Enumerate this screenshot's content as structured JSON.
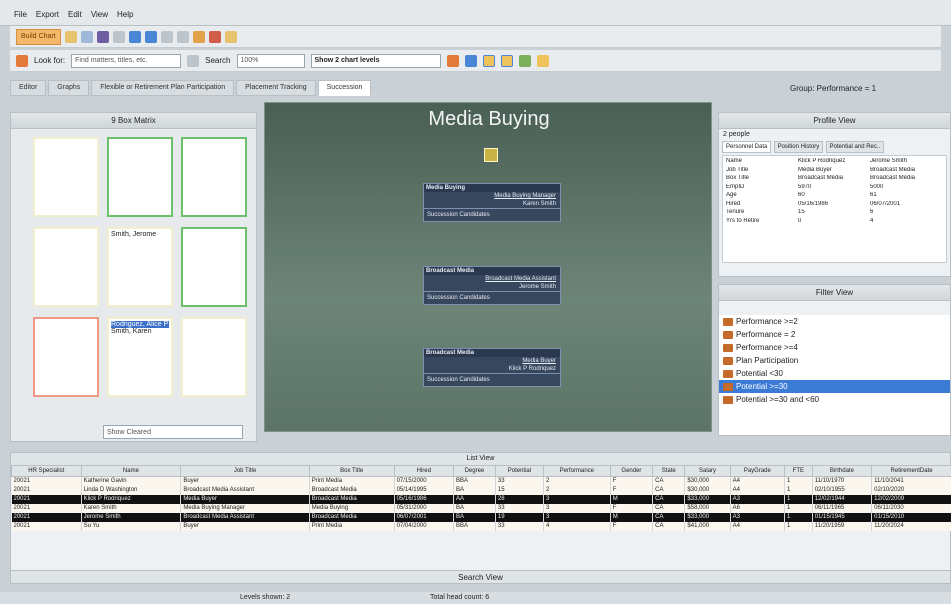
{
  "menu": [
    "File",
    "Export",
    "Edit",
    "View",
    "Help"
  ],
  "toolbar": {
    "main_button": "Build Chart",
    "look_for_label": "Look for:",
    "look_for_placeholder": "Find matters, titles, etc.",
    "search_label": "Search",
    "zoom": "100%",
    "chart_levels": "Show 2 chart levels"
  },
  "tabs": [
    "Editor",
    "Graphs",
    "Flexible or Retirement Plan Participation",
    "Placement Tracking",
    "Succession"
  ],
  "group_label": "Group: Performance = 1",
  "matrix": {
    "title": "9 Box Matrix",
    "cell_names_1": [
      "Smith, Jerome"
    ],
    "cell_names_2": [
      "Rodriguez, Alice P",
      "Smith, Karen"
    ],
    "show_select": "Show Cleared"
  },
  "chart": {
    "title": "Media Buying",
    "nodes": [
      {
        "dept": "Media Buying",
        "title": "Media Buying Manager",
        "name": "Karen Smith",
        "succ": "Succession Candidates"
      },
      {
        "dept": "Broadcast Media",
        "title": "Broadcast Media Assistant",
        "name": "Jerome Smith",
        "succ": "Succession Candidates"
      },
      {
        "dept": "Broadcast Media",
        "title": "Media Buyer",
        "name": "Klick P Rodriquez",
        "succ": "Succession Candidates"
      }
    ]
  },
  "profile": {
    "title": "Profile View",
    "compare": "2 people",
    "tabs": [
      "Personnel Data",
      "Position History",
      "Potential and Rec.."
    ],
    "rows": [
      [
        "Name",
        "Klick P Rodriquez",
        "Jerome Smith"
      ],
      [
        "Job Title",
        "Media Buyer",
        "Broadcast Media"
      ],
      [
        "Box Title",
        "Broadcast Media",
        "Broadcast Media"
      ],
      [
        "EmpID",
        "5970",
        "5000"
      ],
      [
        "Age",
        "60",
        "61"
      ],
      [
        "Hired",
        "05/16/1986",
        "06/07/2001"
      ],
      [
        "Tenure",
        "15",
        "6"
      ],
      [
        "Yrs to Retire",
        "0",
        "4"
      ]
    ]
  },
  "filter": {
    "title": "Filter View",
    "items": [
      "Performance >=2",
      "Performance = 2",
      "Performance >=4",
      "Plan Participation",
      "Potential <30",
      "Potential >=30",
      "Potential >=30 and <60"
    ],
    "selected": 5
  },
  "list": {
    "title": "List View",
    "columns": [
      "HR Specialist",
      "Name",
      "Job Title",
      "Box Title",
      "Hired",
      "Degree",
      "Potential",
      "Performance",
      "Gender",
      "State",
      "Salary",
      "PayGrade",
      "FTE",
      "Birthdate",
      "RetirementDate"
    ],
    "rows": [
      [
        "20021",
        "Katherine Gavin",
        "Buyer",
        "Print Media",
        "07/15/2000",
        "BBA",
        "33",
        "2",
        "F",
        "CA",
        "$30,000",
        "A4",
        "1",
        "11/10/1970",
        "11/10/2041"
      ],
      [
        "20021",
        "Linda D Washington",
        "Broadcast Media Assistant",
        "Broadcast Media",
        "05/14/1995",
        "BA",
        "15",
        "2",
        "F",
        "CA",
        "$30,000",
        "A4",
        "1",
        "02/10/1955",
        "02/10/2020"
      ],
      [
        "20021",
        "Klick P Rodriquez",
        "Media Buyer",
        "Broadcast Media",
        "05/16/1986",
        "AA",
        "28",
        "3",
        "M",
        "CA",
        "$33,000",
        "A3",
        "1",
        "12/02/1944",
        "12/02/2009"
      ],
      [
        "20021",
        "Karen Smith",
        "Media Buying Manager",
        "Media Buying",
        "05/31/2000",
        "BA",
        "33",
        "3",
        "F",
        "CA",
        "$58,000",
        "A6",
        "1",
        "06/11/1965",
        "06/11/2030"
      ],
      [
        "20021",
        "Jerome Smith",
        "Broadcast Media Assistant",
        "Broadcast Media",
        "06/07/2001",
        "BA",
        "19",
        "3",
        "M",
        "CA",
        "$33,000",
        "A3",
        "1",
        "01/15/1945",
        "01/15/2010"
      ],
      [
        "20021",
        "Su Yu",
        "Buyer",
        "Print Media",
        "07/04/2000",
        "BBA",
        "33",
        "4",
        "F",
        "CA",
        "$41,000",
        "A4",
        "1",
        "11/20/1959",
        "11/20/2024"
      ]
    ],
    "row_styles": [
      "light",
      "light",
      "dark",
      "light",
      "dark",
      "light"
    ]
  },
  "search_view": "Search View",
  "status": {
    "levels": "Levels shown: 2",
    "headcount": "Total head count: 6"
  }
}
